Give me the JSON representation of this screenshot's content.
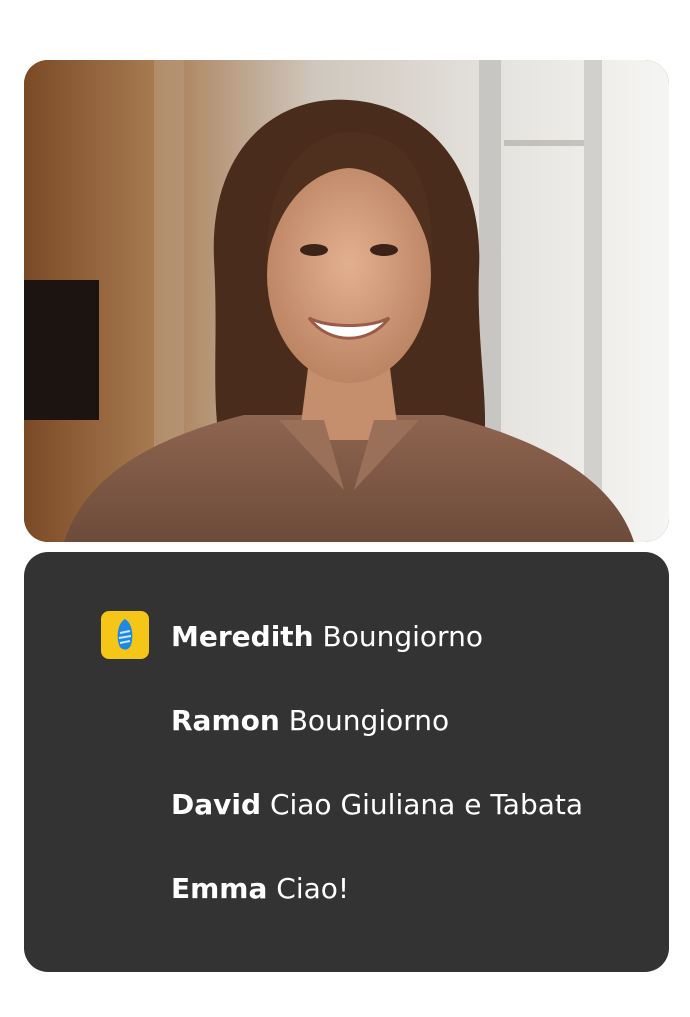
{
  "video": {
    "image_subject": "smiling woman with brown hair in brown shirt, video call"
  },
  "chat": {
    "app_icon": "rosetta-stone-icon",
    "accent_color": "#f5c518",
    "panel_color": "#333333",
    "messages": [
      {
        "name": "Meredith",
        "text": "Boungiorno"
      },
      {
        "name": "Ramon",
        "text": "Boungiorno"
      },
      {
        "name": "David",
        "text": "Ciao Giuliana e Tabata"
      },
      {
        "name": "Emma",
        "text": "Ciao!"
      }
    ]
  }
}
